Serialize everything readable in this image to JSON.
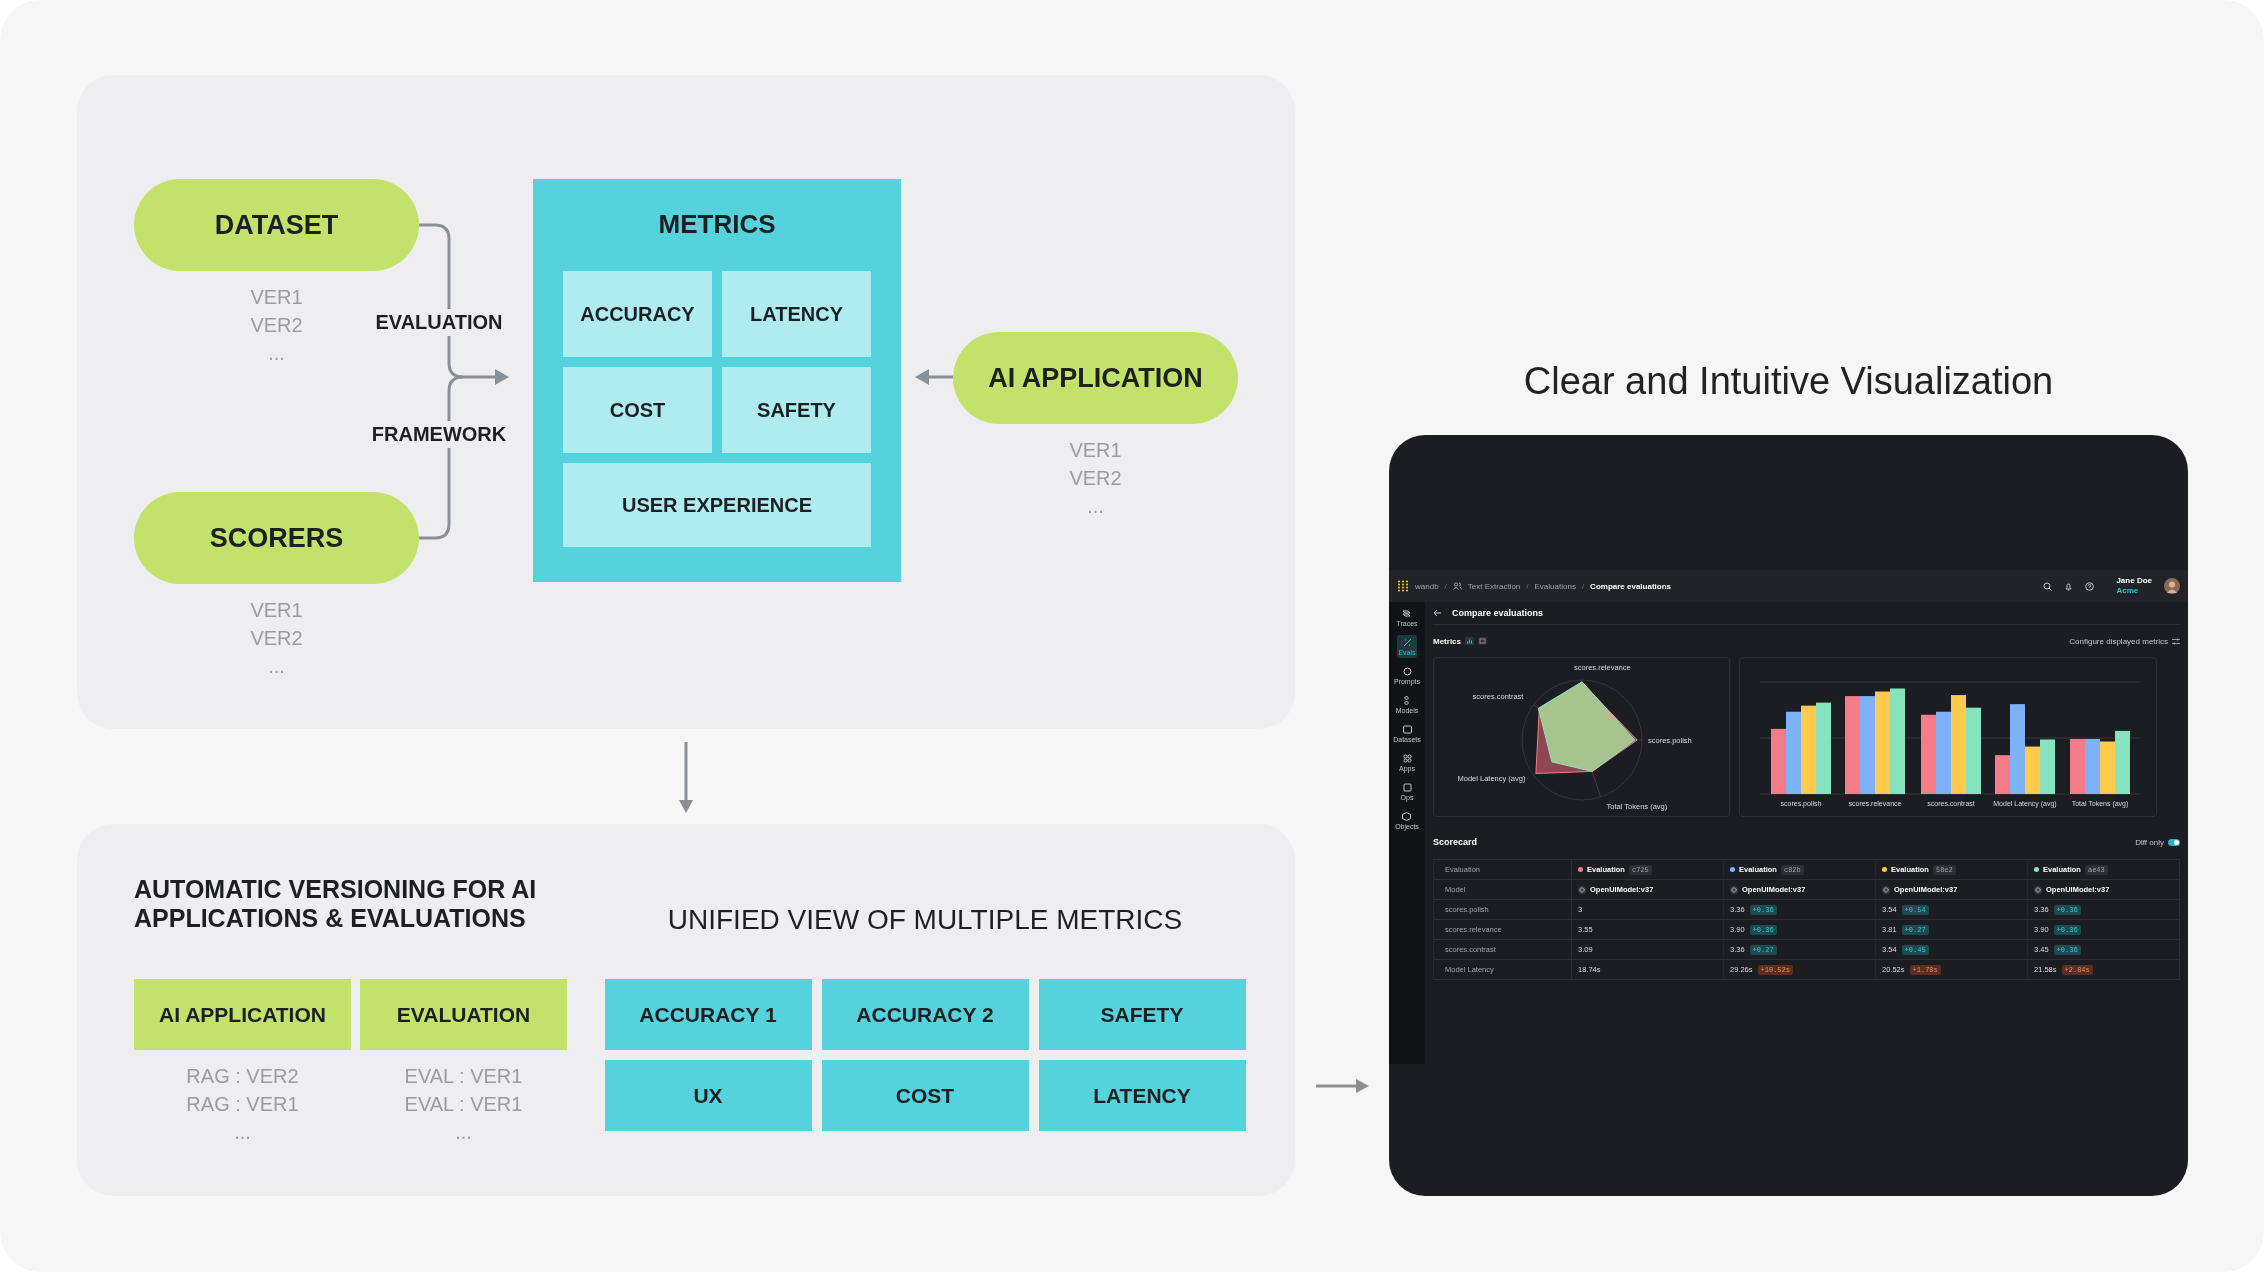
{
  "diagram": {
    "sources": [
      {
        "label": "DATASET",
        "versions": [
          "VER1",
          "VER2",
          "..."
        ]
      },
      {
        "label": "SCORERS",
        "versions": [
          "VER1",
          "VER2",
          "..."
        ]
      }
    ],
    "connector_labels": [
      "EVALUATION",
      "FRAMEWORK"
    ],
    "metrics": {
      "title": "METRICS",
      "items": [
        "ACCURACY",
        "LATENCY",
        "COST",
        "SAFETY",
        "USER EXPERIENCE"
      ]
    },
    "application": {
      "label": "AI APPLICATION",
      "versions": [
        "VER1",
        "VER2",
        "..."
      ]
    }
  },
  "versioning": {
    "title": "AUTOMATIC VERSIONING FOR AI APPLICATIONS & EVALUATIONS",
    "columns": [
      {
        "label": "AI APPLICATION",
        "versions": [
          "RAG : VER2",
          "RAG : VER1",
          "..."
        ]
      },
      {
        "label": "EVALUATION",
        "versions": [
          "EVAL : VER1",
          "EVAL : VER1",
          "..."
        ]
      }
    ]
  },
  "unified": {
    "title": "UNIFIED VIEW OF MULTIPLE METRICS",
    "items": [
      "ACCURACY 1",
      "ACCURACY 2",
      "SAFETY",
      "UX",
      "COST",
      "LATENCY"
    ]
  },
  "visualization": {
    "title": "Clear and Intuitive Visualization",
    "app": {
      "breadcrumb": [
        "wandb",
        "Text Extraction",
        "Evaluations",
        "Compare evaluations"
      ],
      "separator": "/",
      "user": {
        "name": "Jane Doe",
        "org": "Acme"
      },
      "nav": [
        {
          "label": "Traces",
          "selected": false
        },
        {
          "label": "Evals",
          "selected": true
        },
        {
          "label": "Prompts",
          "selected": false
        },
        {
          "label": "Models",
          "selected": false
        },
        {
          "label": "Datasets",
          "selected": false
        },
        {
          "label": "Apps",
          "selected": false
        },
        {
          "label": "Ops",
          "selected": false
        },
        {
          "label": "Objects",
          "selected": false
        }
      ],
      "page_title": "Compare evaluations",
      "metrics_label": "Metrics",
      "configure": "Configure displayed metrics",
      "radar_axes": [
        "scores.relevance",
        "scores.contrast",
        "scores.polish",
        "Model Latency (avg)",
        "Total Tokens (avg)"
      ],
      "bar_categories": [
        "scores.polish",
        "scores.relevance",
        "scores.contrast",
        "Model Latency (avg)",
        "Total Tokens (avg)"
      ],
      "scorecard": {
        "title": "Scorecard",
        "diff_only": {
          "label": "Diff only",
          "on": true
        },
        "header_labels": [
          "Evaluation",
          "Model"
        ],
        "evaluations": [
          {
            "name": "Evaluation",
            "tag": "c725",
            "color": "#f47c88",
            "model": "OpenUIModel:v37"
          },
          {
            "name": "Evaluation",
            "tag": "c82b",
            "color": "#7eb2f8",
            "model": "OpenUIModel:v37"
          },
          {
            "name": "Evaluation",
            "tag": "58e2",
            "color": "#fdca4b",
            "model": "OpenUIModel:v37"
          },
          {
            "name": "Evaluation",
            "tag": "ae43",
            "color": "#86e3be",
            "model": "OpenUIModel:v37"
          }
        ],
        "rows": [
          {
            "label": "scores.polish",
            "cells": [
              {
                "value": "3"
              },
              {
                "value": "3.36",
                "delta": "+0.36",
                "worse": false
              },
              {
                "value": "3.54",
                "delta": "+0.54",
                "worse": false
              },
              {
                "value": "3.36",
                "delta": "+0.36",
                "worse": false
              }
            ]
          },
          {
            "label": "scores.relevance",
            "cells": [
              {
                "value": "3.55"
              },
              {
                "value": "3.90",
                "delta": "+0.36",
                "worse": false
              },
              {
                "value": "3.81",
                "delta": "+0.27",
                "worse": false
              },
              {
                "value": "3.90",
                "delta": "+0.36",
                "worse": false
              }
            ]
          },
          {
            "label": "scores.contrast",
            "cells": [
              {
                "value": "3.09"
              },
              {
                "value": "3.36",
                "delta": "+0.27",
                "worse": false
              },
              {
                "value": "3.54",
                "delta": "+0.45",
                "worse": false
              },
              {
                "value": "3.45",
                "delta": "+0.36",
                "worse": false
              }
            ]
          },
          {
            "label": "Model Latency",
            "cells": [
              {
                "value": "18.74s"
              },
              {
                "value": "29.26s",
                "delta": "+10.52s",
                "worse": true
              },
              {
                "value": "20.52s",
                "delta": "+1.78s",
                "worse": true
              },
              {
                "value": "21.58s",
                "delta": "+2.84s",
                "worse": true
              }
            ]
          }
        ]
      }
    }
  }
}
